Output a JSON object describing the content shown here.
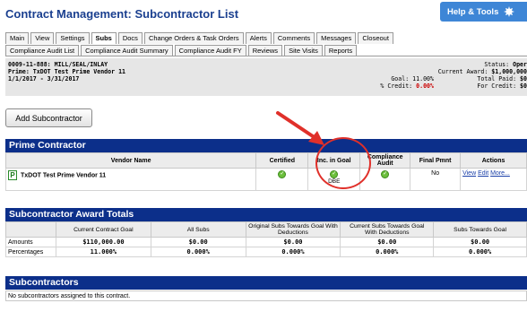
{
  "page": {
    "title": "Contract Management: Subcontractor List"
  },
  "help": {
    "label": "Help & Tools"
  },
  "tabs_row1": [
    "Main",
    "View",
    "Settings",
    "Subs",
    "Docs",
    "Change Orders & Task Orders",
    "Alerts",
    "Comments",
    "Messages",
    "Closeout"
  ],
  "tabs_row2": [
    "Compliance Audit List",
    "Compliance Audit Summary",
    "Compliance Audit FY",
    "Reviews",
    "Site Visits",
    "Reports"
  ],
  "active_tab": "Subs",
  "contract": {
    "line1": "0009-11-888: MILL/SEAL/INLAY",
    "line2": "Prime: TxDOT Test Prime Vendor 11",
    "line3": "1/1/2017 - 3/31/2017",
    "goal_label": "Goal:",
    "goal_value": "11.00%",
    "credit_label": "% Credit:",
    "credit_value": "0.00%",
    "status_label": "Status:",
    "status_value": "Oper",
    "award_label": "Current Award:",
    "award_value": "$1,000,000",
    "paid_label": "Total Paid:",
    "paid_value": "$0",
    "credit2_label": "For Credit:",
    "credit2_value": "$0"
  },
  "add_button": "Add Subcontractor",
  "prime": {
    "header": "Prime Contractor",
    "columns": [
      "Vendor Name",
      "Certified",
      "Inc. in Goal",
      "Compliance Audit",
      "Final Pmnt",
      "Actions"
    ],
    "row": {
      "badge": "P",
      "vendor": "TxDOT Test Prime Vendor 11",
      "inc_goal_note": "DBE",
      "final_pmnt": "No",
      "actions": [
        "View",
        "Edit",
        "More..."
      ]
    }
  },
  "totals": {
    "header": "Subcontractor Award Totals",
    "columns": [
      "Current Contract Goal",
      "All Subs",
      "Original Subs Towards Goal With Deductions",
      "Current Subs Towards Goal With Deductions",
      "Subs Towards Goal"
    ],
    "rows": [
      {
        "label": "Amounts",
        "values": [
          "$110,000.00",
          "$0.00",
          "$0.00",
          "$0.00",
          "$0.00"
        ]
      },
      {
        "label": "Percentages",
        "values": [
          "11.000%",
          "0.000%",
          "0.000%",
          "0.000%",
          "0.000%"
        ]
      }
    ]
  },
  "subs": {
    "header": "Subcontractors",
    "empty_message": "No subcontractors assigned to this contract."
  },
  "colors": {
    "accent": "#0c2f8a",
    "title": "#1a3f8f",
    "help_bg": "#3e86d6",
    "annotation": "#e0302a"
  }
}
